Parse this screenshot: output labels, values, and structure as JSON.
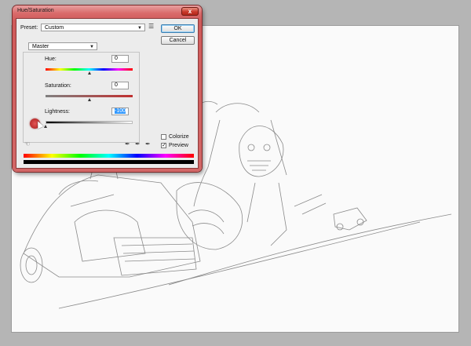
{
  "dialog": {
    "title": "Hue/Saturation",
    "preset_label": "Preset:",
    "preset_value": "Custom",
    "ok_label": "OK",
    "cancel_label": "Cancel",
    "channel": "Master",
    "hue_label": "Hue:",
    "hue_value": "0",
    "saturation_label": "Saturation:",
    "saturation_value": "0",
    "lightness_label": "Lightness:",
    "lightness_value": "-100",
    "colorize_label": "Colorize",
    "colorize_checked": false,
    "preview_label": "Preview",
    "preview_checked": true,
    "close_symbol": "x",
    "check_symbol": "✓"
  },
  "sliders": {
    "hue_fraction": 0.5,
    "saturation_fraction": 0.5,
    "lightness_fraction": 0.0
  },
  "icons": [
    "close-icon",
    "preset-options-icon",
    "dropdown-arrow-icon",
    "hand-adjust-icon",
    "eyedropper-icon",
    "eyedropper-plus-icon",
    "eyedropper-minus-icon",
    "mouse-pointer-icon"
  ],
  "colors": {
    "titlebar": "#d96a6a",
    "selection": "#3399ff",
    "sketch_line": "#8a8a8a"
  }
}
